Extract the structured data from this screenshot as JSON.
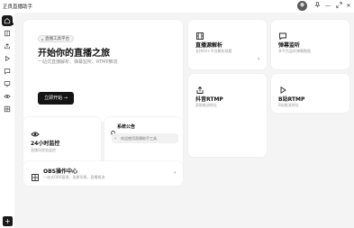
{
  "app": {
    "title": "正良直播助手"
  },
  "titlebar": {
    "pin_icon": "pin-icon",
    "minimize_glyph": "—",
    "maximize_icon": "expand-icon",
    "close_glyph": "✕"
  },
  "sidebar": {
    "items": [
      {
        "name": "home",
        "icon": "home-icon",
        "active": true
      },
      {
        "name": "book",
        "icon": "book-icon"
      },
      {
        "name": "upload",
        "icon": "upload-icon"
      },
      {
        "name": "play",
        "icon": "play-icon"
      },
      {
        "name": "message",
        "icon": "message-icon"
      },
      {
        "name": "monitor",
        "icon": "monitor-icon"
      },
      {
        "name": "eye",
        "icon": "eye-icon"
      },
      {
        "name": "grid",
        "icon": "grid-icon"
      }
    ],
    "add_label": "+"
  },
  "hero": {
    "badge": "直播工具平台",
    "title": "开始你的直播之旅",
    "subtitle": "一站式直播解析、弹幕监听、RTMP推流",
    "cta": "立即开始",
    "cta_arrow": "→"
  },
  "live_monitor": {
    "title": "24小时监控",
    "desc": "直播间状态监控"
  },
  "announcement": {
    "title": "系统公告",
    "item": "欢迎使用直播助手工具"
  },
  "obs": {
    "title": "OBS操作中心",
    "desc": "一站式OBS管理，场景切换，直播推流",
    "chevron": "›"
  },
  "features": [
    {
      "title": "直播源解析",
      "desc": "支持50+平台解析观看",
      "icon": "film-icon",
      "chevron": "›"
    },
    {
      "title": "弹幕监听",
      "desc": "多平台监听弹幕数据",
      "icon": "message-icon"
    },
    {
      "title": "抖音RTMP",
      "desc": "获取推流地址",
      "icon": "share-icon"
    },
    {
      "title": "B站RTMP",
      "desc": "B站推流地址",
      "icon": "play-icon"
    }
  ]
}
